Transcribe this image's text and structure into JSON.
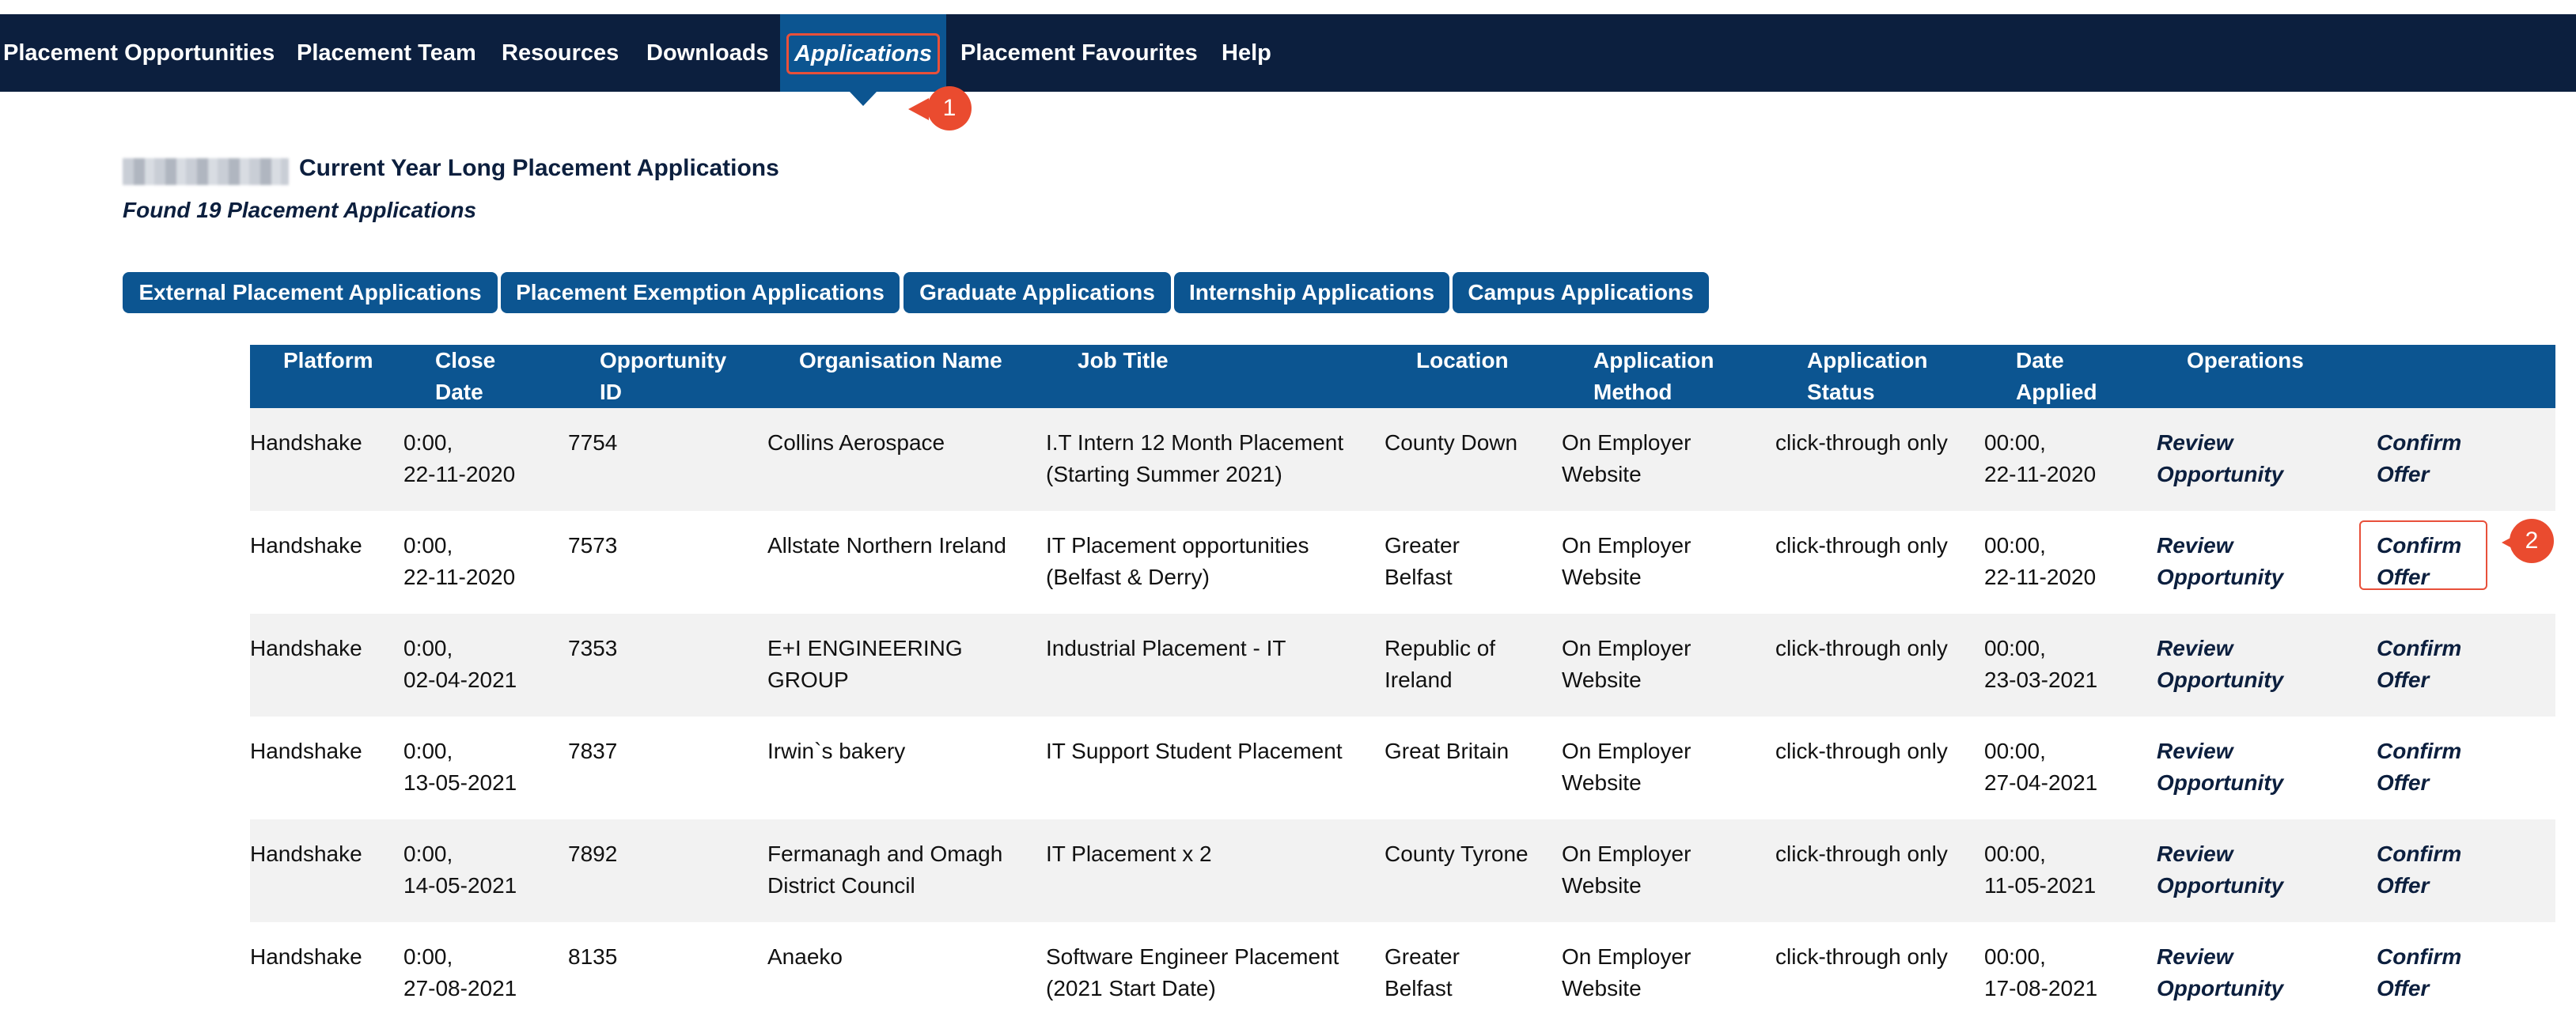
{
  "nav": {
    "items": [
      {
        "label": "Placement Opportunities"
      },
      {
        "label": "Placement Team"
      },
      {
        "label": "Resources"
      },
      {
        "label": "Downloads"
      },
      {
        "label": "Applications"
      },
      {
        "label": "Placement Favourites"
      },
      {
        "label": "Help"
      }
    ],
    "active_label": "Applications"
  },
  "markers": {
    "first": "1",
    "second": "2"
  },
  "page": {
    "title": "Current Year Long Placement Applications",
    "found": "Found 19 Placement Applications"
  },
  "tabs": [
    {
      "label": "External Placement Applications"
    },
    {
      "label": "Placement Exemption Applications"
    },
    {
      "label": "Graduate Applications"
    },
    {
      "label": "Internship Applications"
    },
    {
      "label": "Campus Applications"
    }
  ],
  "table": {
    "headers": {
      "platform": "Platform",
      "close_date": "Close\nDate",
      "opportunity_id": "Opportunity\nID",
      "organisation": "Organisation Name",
      "job_title": "Job Title",
      "location": "Location",
      "method": "Application\nMethod",
      "status": "Application\nStatus",
      "date_applied": "Date\nApplied",
      "operations": "Operations"
    },
    "review_label": "Review\nOpportunity",
    "confirm_label": "Confirm\nOffer",
    "rows": [
      {
        "platform": "Handshake",
        "close_date": "0:00,\n22-11-2020",
        "id": "7754",
        "organisation": "Collins Aerospace",
        "job_title": "I.T Intern 12 Month Placement\n(Starting Summer 2021)",
        "location": "County Down",
        "method": "On Employer\nWebsite",
        "status": "click-through only",
        "date_applied": "00:00,\n22-11-2020"
      },
      {
        "platform": "Handshake",
        "close_date": "0:00,\n22-11-2020",
        "id": "7573",
        "organisation": "Allstate Northern Ireland",
        "job_title": "IT Placement opportunities\n(Belfast & Derry)",
        "location": "Greater\nBelfast",
        "method": "On Employer\nWebsite",
        "status": "click-through only",
        "date_applied": "00:00,\n22-11-2020"
      },
      {
        "platform": "Handshake",
        "close_date": "0:00,\n02-04-2021",
        "id": "7353",
        "organisation": "E+I ENGINEERING\nGROUP",
        "job_title": "Industrial Placement - IT",
        "location": "Republic of\nIreland",
        "method": "On Employer\nWebsite",
        "status": "click-through only",
        "date_applied": "00:00,\n23-03-2021"
      },
      {
        "platform": "Handshake",
        "close_date": "0:00,\n13-05-2021",
        "id": "7837",
        "organisation": "Irwin`s bakery",
        "job_title": "IT Support Student Placement",
        "location": "Great Britain",
        "method": "On Employer\nWebsite",
        "status": "click-through only",
        "date_applied": "00:00,\n27-04-2021"
      },
      {
        "platform": "Handshake",
        "close_date": "0:00,\n14-05-2021",
        "id": "7892",
        "organisation": "Fermanagh and Omagh\nDistrict Council",
        "job_title": "IT Placement x 2",
        "location": "County Tyrone",
        "method": "On Employer\nWebsite",
        "status": "click-through only",
        "date_applied": "00:00,\n11-05-2021"
      },
      {
        "platform": "Handshake",
        "close_date": "0:00,\n27-08-2021",
        "id": "8135",
        "organisation": "Anaeko",
        "job_title": "Software Engineer Placement\n(2021 Start Date)",
        "location": "Greater\nBelfast",
        "method": "On Employer\nWebsite",
        "status": "click-through only",
        "date_applied": "00:00,\n17-08-2021"
      }
    ]
  },
  "colors": {
    "nav_bg": "#0c1f3e",
    "accent": "#0c5591",
    "marker": "#ea4b2f",
    "row_alt": "#f2f2f2"
  }
}
